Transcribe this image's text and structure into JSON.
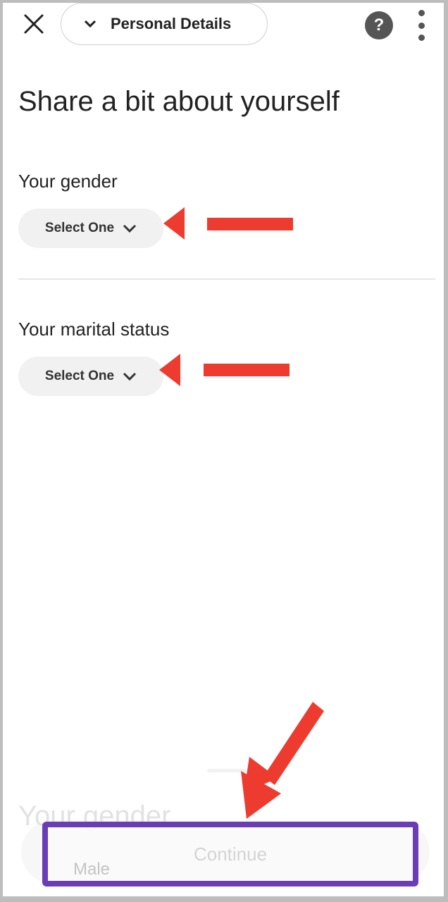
{
  "header": {
    "close_icon": "close-icon",
    "step_label": "Personal Details",
    "help_icon": "help-icon",
    "help_glyph": "?",
    "more_icon": "more-vertical-icon"
  },
  "main": {
    "title": "Share a bit about yourself",
    "questions": [
      {
        "label": "Your gender",
        "select_value": "Select One"
      },
      {
        "label": "Your marital status",
        "select_value": "Select One"
      }
    ],
    "continue_label": "Continue"
  },
  "background_sheet": {
    "title": "Your gender",
    "option": "Male"
  },
  "annotations": {
    "arrow_color": "#ee3b2f",
    "highlight_color": "#6a3db5"
  }
}
